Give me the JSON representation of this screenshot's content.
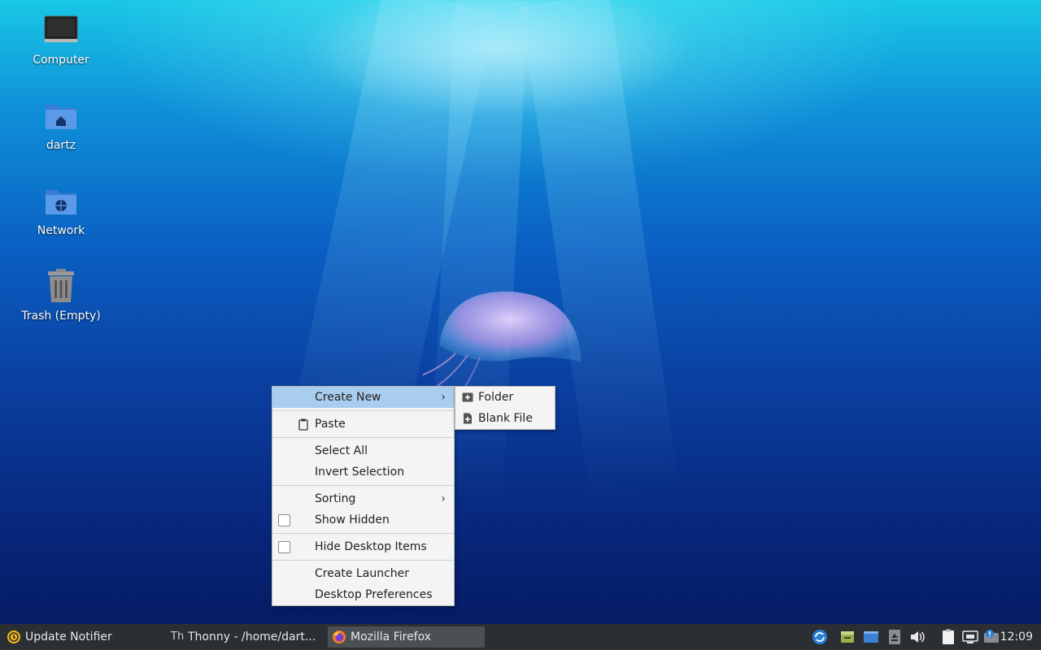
{
  "desktop": {
    "icons": [
      {
        "label": "Computer",
        "icon": "computer-icon"
      },
      {
        "label": "dartz",
        "icon": "home-folder-icon"
      },
      {
        "label": "Network",
        "icon": "network-folder-icon"
      },
      {
        "label": "Trash (Empty)",
        "icon": "trash-icon"
      }
    ]
  },
  "context_menu": {
    "create_new": "Create New",
    "paste": "Paste",
    "select_all": "Select All",
    "invert_selection": "Invert Selection",
    "sorting": "Sorting",
    "show_hidden": "Show Hidden",
    "hide_desktop_items": "Hide Desktop Items",
    "create_launcher": "Create Launcher",
    "desktop_preferences": "Desktop Preferences",
    "arrow": ">"
  },
  "submenu": {
    "folder": "Folder",
    "blank_file": "Blank File"
  },
  "taskbar": {
    "update_notifier": "Update Notifier",
    "thonny": "Thonny  -  /home/dart...",
    "thonny_icon_text": "Th",
    "firefox": "Mozilla Firefox",
    "clock": "12:09"
  },
  "colors": {
    "menu_highlight": "#a9cdee",
    "taskbar_bg": "#2b2f33"
  }
}
